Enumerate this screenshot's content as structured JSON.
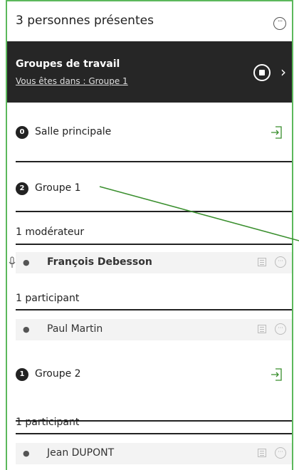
{
  "header": {
    "title": "3 personnes présentes",
    "more_icon": "more-icon"
  },
  "banner": {
    "title": "Groupes de travail",
    "subtitle": "Vous êtes dans : Groupe 1"
  },
  "rooms": {
    "main": {
      "count": "0",
      "label": "Salle principale"
    },
    "group1": {
      "count": "2",
      "label": "Groupe 1",
      "moderators_label": "1 modérateur",
      "participants_label": "1 participant",
      "moderator": "François Debesson",
      "participant": "Paul Martin"
    },
    "group2": {
      "count": "1",
      "label": "Groupe 2",
      "participants_label": "1 participant",
      "participant": "Jean DUPONT"
    }
  },
  "colors": {
    "frame": "#5cb85c",
    "banner": "#262626",
    "annotation_line": "#3a8f2e"
  }
}
